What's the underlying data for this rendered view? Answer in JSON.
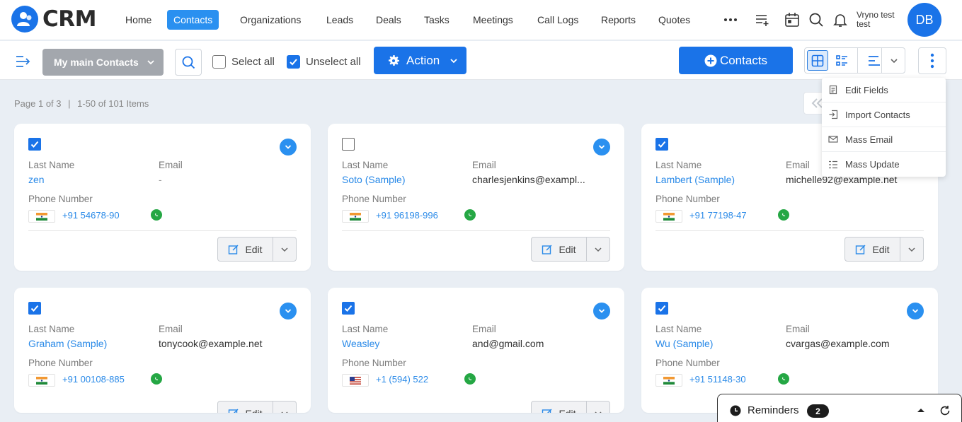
{
  "app": {
    "name": "CRM"
  },
  "nav": {
    "items": [
      {
        "label": "Home",
        "active": false
      },
      {
        "label": "Contacts",
        "active": true
      },
      {
        "label": "Organizations",
        "active": false
      },
      {
        "label": "Leads",
        "active": false
      },
      {
        "label": "Deals",
        "active": false
      },
      {
        "label": "Tasks",
        "active": false
      },
      {
        "label": "Meetings",
        "active": false
      },
      {
        "label": "Call Logs",
        "active": false
      },
      {
        "label": "Reports",
        "active": false
      },
      {
        "label": "Quotes",
        "active": false
      }
    ],
    "more_icon": "ellipsis-icon",
    "icons": [
      "add-list-icon",
      "calendar-icon",
      "search-icon",
      "bell-icon"
    ]
  },
  "user": {
    "name_line1": "Vryno test",
    "name_line2": "test",
    "initials": "DB"
  },
  "toolbar": {
    "view_name": "My main Contacts",
    "select_all_label": "Select all",
    "select_all_checked": false,
    "unselect_all_label": "Unselect all",
    "unselect_all_checked": true,
    "action_label": "Action",
    "add_label": "Contacts"
  },
  "pagination": {
    "page_text": "Page 1 of 3",
    "items_text": "1-50 of 101 Items"
  },
  "labels": {
    "last_name": "Last Name",
    "email": "Email",
    "phone": "Phone Number",
    "edit": "Edit"
  },
  "cards": [
    {
      "checked": true,
      "last_name": "zen",
      "email": "-",
      "phone": "+91 54678-90",
      "country": "IN"
    },
    {
      "checked": false,
      "last_name": "Soto (Sample)",
      "email": "charlesjenkins@exampl...",
      "phone": "+91 96198-996",
      "country": "IN"
    },
    {
      "checked": true,
      "last_name": "Lambert (Sample)",
      "email": "michelle92@example.net",
      "phone": "+91 77198-47",
      "country": "IN"
    },
    {
      "checked": true,
      "last_name": "Graham (Sample)",
      "email": "tonycook@example.net",
      "phone": "+91 00108-885",
      "country": "IN"
    },
    {
      "checked": true,
      "last_name": "Weasley",
      "email": "and@gmail.com",
      "phone": "+1 (594) 522",
      "country": "US"
    },
    {
      "checked": true,
      "last_name": "Wu (Sample)",
      "email": "cvargas@example.com",
      "phone": "+91 51148-30",
      "country": "IN"
    }
  ],
  "menu": {
    "items": [
      {
        "label": "Edit Fields",
        "icon": "document-icon"
      },
      {
        "label": "Import Contacts",
        "icon": "import-icon"
      },
      {
        "label": "Mass Email",
        "icon": "mail-icon"
      },
      {
        "label": "Mass Update",
        "icon": "list-update-icon"
      }
    ]
  },
  "reminders": {
    "label": "Reminders",
    "count": "2"
  },
  "colors": {
    "primary": "#1a73e8",
    "accent": "#2a90f0",
    "whatsapp": "#25a744"
  }
}
